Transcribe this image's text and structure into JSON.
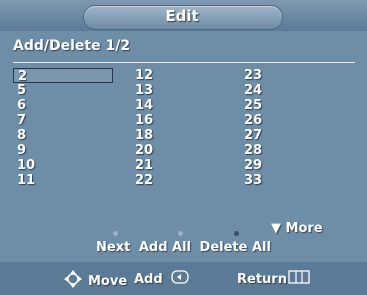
{
  "header": {
    "title": "Edit"
  },
  "subtitle": "Add/Delete 1/2",
  "channels": {
    "col1": [
      "2",
      "5",
      "6",
      "7",
      "8",
      "9",
      "10",
      "11"
    ],
    "col2": [
      "12",
      "13",
      "14",
      "16",
      "18",
      "20",
      "21",
      "22"
    ],
    "col3": [
      "23",
      "24",
      "25",
      "26",
      "27",
      "28",
      "29",
      "33"
    ],
    "selected": "2"
  },
  "more_label": "More",
  "actions": {
    "next": "Next",
    "add_all": "Add All",
    "delete_all": "Delete All"
  },
  "footer": {
    "move_label": "Move",
    "add_label": "Add",
    "return_label": "Return"
  }
}
